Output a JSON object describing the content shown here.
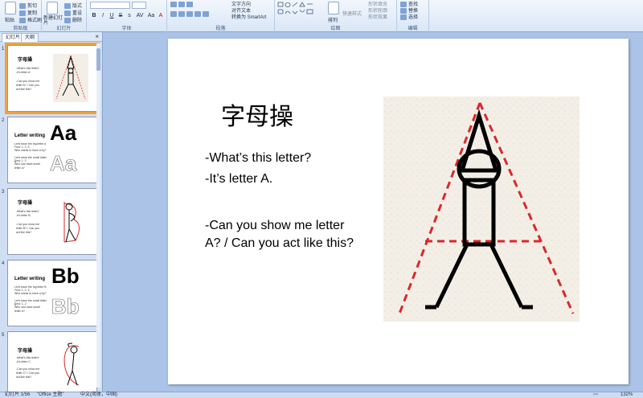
{
  "ribbon": {
    "clipboard": {
      "group_label": "剪贴板",
      "paste": "粘贴",
      "cut": "剪切",
      "copy": "复制",
      "format_painter": "格式刷"
    },
    "slides": {
      "group_label": "幻灯片",
      "new_slide": "新建幻灯片",
      "layout": "版式",
      "reset": "重设",
      "delete": "删除"
    },
    "font": {
      "group_label": "字体",
      "bold": "B",
      "italic": "I",
      "underline": "U",
      "strike": "S",
      "shadow": "s",
      "spacing": "AV",
      "case": "Aa",
      "color": "A"
    },
    "paragraph": {
      "group_label": "段落",
      "text_direction": "文字方向",
      "align_text": "对齐文本",
      "smartart": "转换为 SmartArt"
    },
    "drawing": {
      "group_label": "绘图",
      "arrange": "排列",
      "quick_styles": "快速样式",
      "shape_fill": "形状填充",
      "shape_outline": "形状轮廓",
      "shape_effects": "形状效果"
    },
    "editing": {
      "group_label": "编辑",
      "find": "查找",
      "replace": "替换",
      "select": "选择"
    }
  },
  "pane": {
    "tab_slides": "幻灯片",
    "tab_outline": "大纲",
    "close": "×"
  },
  "thumbnails": [
    {
      "num": "1",
      "title": "字母操",
      "lines": [
        "-What's this letter?",
        "-It's letter A.",
        "",
        "-Can you show me letter A? / Can you act like this?"
      ]
    },
    {
      "num": "2",
      "title": "Letter writing",
      "big": "Aa",
      "lines": [
        "Let's trace the big letter A",
        "First: 1, 2, 3",
        "Who wants to have a try?",
        "",
        "Let's trace the small letter a",
        "First: 1, 2",
        "Who can trace small letter a?"
      ]
    },
    {
      "num": "3",
      "title": "字母操",
      "lines": [
        "-What's this letter?",
        "-It's letter B.",
        "",
        "-Can you show me letter B? / Can you act like this?"
      ]
    },
    {
      "num": "4",
      "title": "Letter writing",
      "big": "Bb",
      "lines": [
        "Let's trace the big letter B",
        "First: 1, 2, 3",
        "Who wants to have a try?",
        "",
        "Let's trace the small letter b",
        "First: 1, 2",
        "Who can trace small letter b?"
      ]
    },
    {
      "num": "5",
      "title": "字母操",
      "lines": [
        "-What's this letter?",
        "-It's letter C.",
        "",
        "-Can you show me letter C? / Can you act like this?"
      ]
    }
  ],
  "slide": {
    "title": "字母操",
    "line1": "-What’s this letter?",
    "line2": "-It’s letter A.",
    "line3": "-Can you show me letter A? / Can you act like this?"
  },
  "status": {
    "slide_count": "幻灯片 1/56",
    "theme": "\"Office 主题\"",
    "language": "中文(简体，中国)",
    "zoom": "132%"
  },
  "colors": {
    "selected_thumb": "#f0a23c",
    "guide_lines": "#d9282a"
  }
}
